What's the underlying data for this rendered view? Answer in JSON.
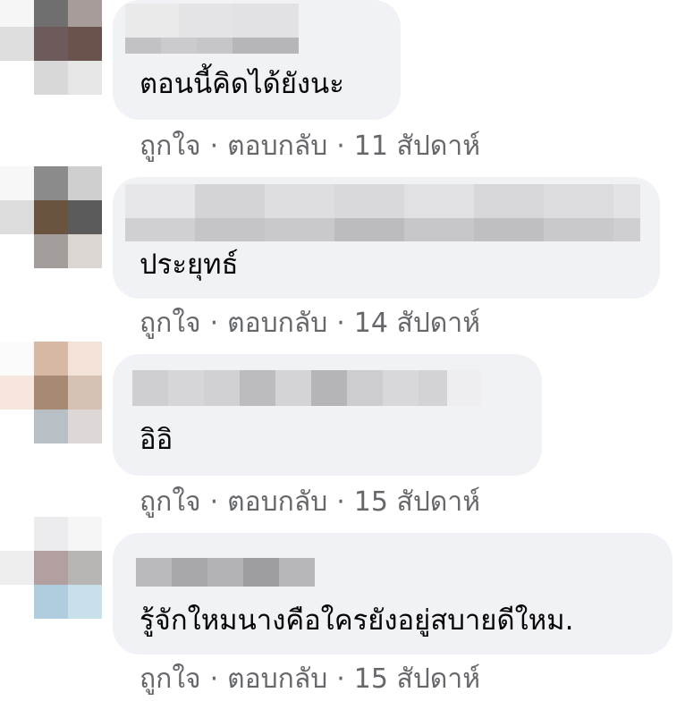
{
  "comments": [
    {
      "text": "ตอนนี้คิดได้ยังนะ",
      "actions": {
        "like": "ถูกใจ",
        "separator": "·",
        "reply": "ตอบกลับ",
        "time": "11 สัปดาห์"
      }
    },
    {
      "text": "ประยุทธ์",
      "actions": {
        "like": "ถูกใจ",
        "separator": "·",
        "reply": "ตอบกลับ",
        "time": "14 สัปดาห์"
      }
    },
    {
      "text": "อิอิ",
      "actions": {
        "like": "ถูกใจ",
        "separator": "·",
        "reply": "ตอบกลับ",
        "time": "15 สัปดาห์"
      }
    },
    {
      "text": "รู้จักใหมนางคือใครยังอยู่สบายดีใหม.",
      "actions": {
        "like": "ถูกใจ",
        "separator": "·",
        "reply": "ตอบกลับ",
        "time": "15 สัปดาห์"
      }
    }
  ],
  "colors": {
    "bubble": "#f0f2f5",
    "text": "#050505",
    "meta": "#65676b"
  }
}
